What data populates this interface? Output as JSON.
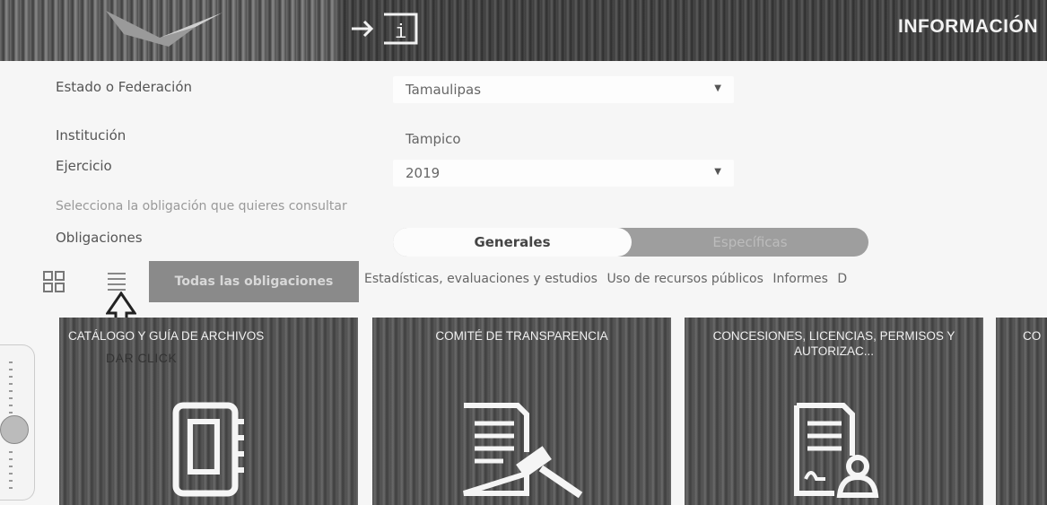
{
  "header": {
    "title": "INFORMACIÓN",
    "logo_icon": "logo-mark",
    "login_icon": "login-info-icon"
  },
  "form": {
    "estado": {
      "label": "Estado o Federación",
      "value": "Tamaulipas"
    },
    "institucion": {
      "label": "Institución",
      "value": "Tampico"
    },
    "ejercicio": {
      "label": "Ejercicio",
      "value": "2019"
    },
    "hint": "Selecciona la obligación que quieres consultar",
    "obligaciones": {
      "label": "Obligaciones",
      "options": [
        "Generales",
        "Específicas"
      ],
      "selected": "Generales"
    }
  },
  "filters": {
    "active": "Todas las obligaciones",
    "links": [
      "Estadísticas, evaluaciones y estudios",
      "Uso de recursos públicos",
      "Informes",
      "D"
    ]
  },
  "annotation": {
    "note": "DAR CLICK"
  },
  "cards": [
    {
      "title": "CATÁLOGO Y GUÍA DE ARCHIVOS",
      "icon": "binder-icon"
    },
    {
      "title": "COMITÉ DE TRANSPARENCIA",
      "icon": "document-gavel-icon"
    },
    {
      "title": "CONCESIONES, LICENCIAS, PERMISOS Y AUTORIZAC...",
      "icon": "document-person-icon"
    },
    {
      "title": "CO",
      "icon": ""
    }
  ],
  "colors": {
    "header_bg": "#3f3f3f",
    "card_bg": "#555555",
    "toggle_bg": "#9e9e9e",
    "filter_active_bg": "#8a8a8a"
  }
}
